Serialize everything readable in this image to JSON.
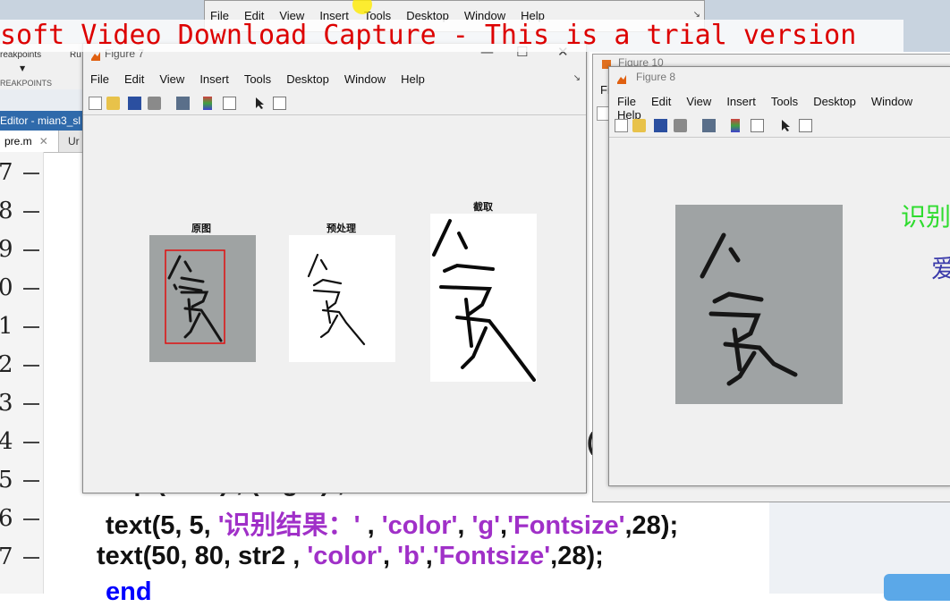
{
  "watermark": {
    "text": "soft Video Download Capture - This is a trial version"
  },
  "background_window_menu": [
    "File",
    "Edit",
    "View",
    "Insert",
    "Tools",
    "Desktop",
    "Window",
    "Help"
  ],
  "ide": {
    "toolstrip_label": "reakpoints",
    "toolstrip_caps": "REAKPOINTS",
    "toolstrip_r": "Ru",
    "editor_title": "Editor - mian3_sl",
    "tabs": [
      {
        "label": "pre.m",
        "close": "✕"
      },
      {
        "label": "Ur"
      }
    ],
    "line_numbers": [
      "7",
      "8",
      "9",
      "0",
      "1",
      "2",
      "3",
      "4",
      "5",
      "6",
      "7"
    ],
    "code": {
      "line_partial": "· ·  p ( · · · ) ,           ( ·   g · ) ;",
      "line_text1_a": "text(5, 5, ",
      "line_text1_b": "'识别结果：'",
      "line_text1_c": " , ",
      "line_text1_d": "'color'",
      "line_text1_e": ", ",
      "line_text1_f": "'g'",
      "line_text1_g": ",",
      "line_text1_h": "'Fontsize'",
      "line_text1_i": ",28);",
      "line_text2_a": "text(50, 80,  str2 , ",
      "line_text2_b": "'color'",
      "line_text2_c": ", ",
      "line_text2_d": "'b'",
      "line_text2_e": ",",
      "line_text2_f": "'Fontsize'",
      "line_text2_g": ",28);",
      "line_end": "end"
    },
    "ghost_paren": "("
  },
  "figure7": {
    "title": "Figure 7",
    "menu": [
      "File",
      "Edit",
      "View",
      "Insert",
      "Tools",
      "Desktop",
      "Window",
      "Help"
    ],
    "menu_arrow": "↘",
    "controls": {
      "minimize": "—",
      "maximize": "☐",
      "close": "✕"
    },
    "subplots": [
      {
        "title": "原图"
      },
      {
        "title": "预处理"
      },
      {
        "title": "截取"
      }
    ],
    "toolbar_icons": [
      "new-figure-icon",
      "open-icon",
      "save-icon",
      "print-icon",
      "link-icon",
      "colorbar-icon",
      "legend-icon",
      "pointer-icon",
      "property-editor-icon"
    ]
  },
  "figure10": {
    "title": "Figure 10",
    "menu_first": "Fil"
  },
  "figure8": {
    "title": "Figure 8",
    "menu": [
      "File",
      "Edit",
      "View",
      "Insert",
      "Tools",
      "Desktop",
      "Window",
      "Help"
    ],
    "result_label": "识别",
    "result_char": "爱",
    "colors": {
      "label": "#2fdc2f",
      "char": "#3a3aaa"
    }
  }
}
